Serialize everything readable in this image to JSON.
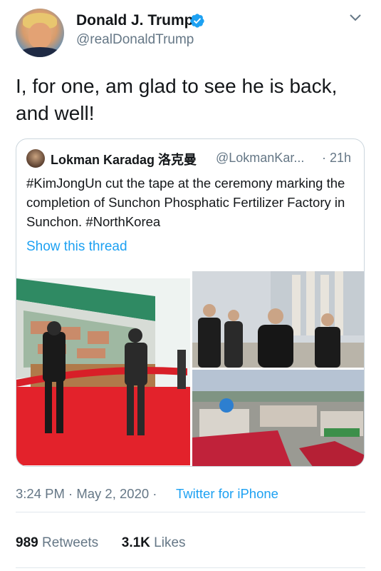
{
  "author": {
    "name": "Donald J. Trump",
    "handle": "@realDonaldTrump",
    "avatar_icon": "profile-photo"
  },
  "tweet_text": "I, for one, am glad to see he is back, and well!",
  "quoted_tweet": {
    "name": "Lokman Karadag 洛克曼",
    "handle": "@LokmanKar...",
    "time": "· 21h",
    "text": "#KimJongUn cut the tape at the ceremony marking the completion of Sunchon Phosphatic Fertilizer Factory in Sunchon. #NorthKorea",
    "show_thread": "Show this thread"
  },
  "meta": {
    "time": "3:24 PM · May 2, 2020 ·",
    "source": "Twitter for iPhone"
  },
  "stats": {
    "retweets_count": "989",
    "retweets_label": "Retweets",
    "likes_count": "3.1K",
    "likes_label": "Likes"
  },
  "colors": {
    "accent": "#1da1f2",
    "secondary_text": "#657786"
  }
}
